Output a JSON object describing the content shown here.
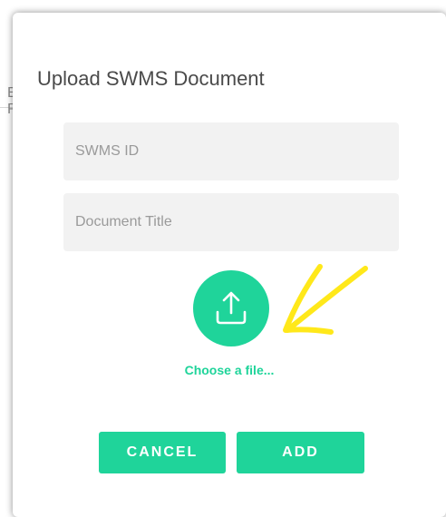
{
  "dialog": {
    "title": "Upload SWMS Document"
  },
  "form": {
    "swms_id_placeholder": "SWMS ID",
    "document_title_placeholder": "Document Title",
    "upload_icon": "upload-tray-icon",
    "choose_file_label": "Choose a file..."
  },
  "actions": {
    "cancel_label": "CANCEL",
    "add_label": "ADD"
  },
  "annotation": {
    "icon": "hand-drawn-arrow-icon"
  },
  "background": {
    "letters": [
      "E",
      "R"
    ]
  },
  "colors": {
    "accent": "#1fd49a",
    "field_bg": "#f2f2f2",
    "title_text": "#4a4a4a",
    "annotation": "#ffe81a"
  }
}
